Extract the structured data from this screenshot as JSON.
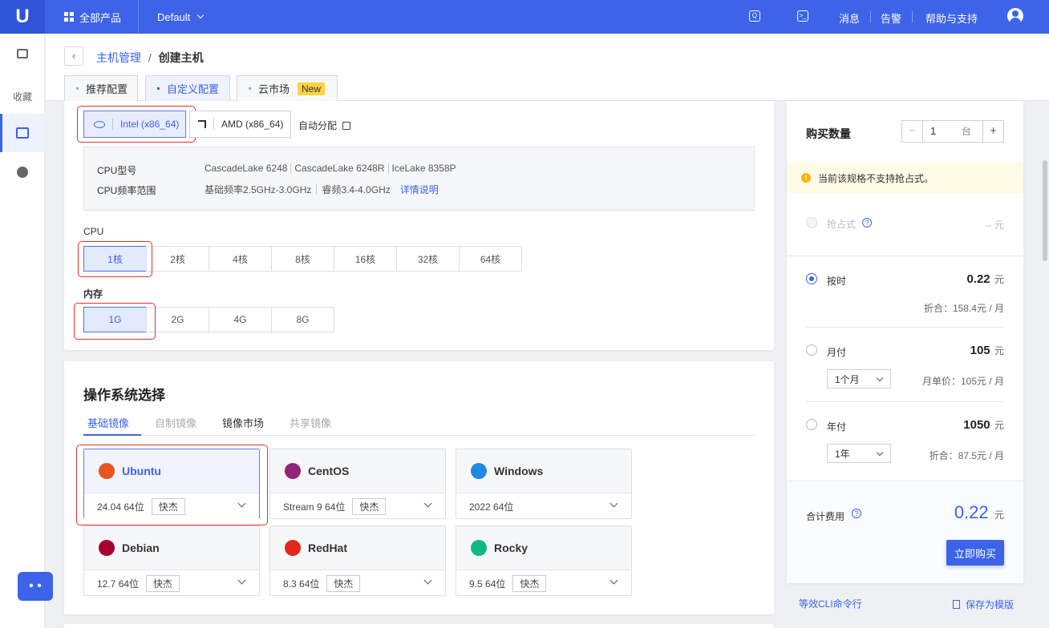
{
  "topbar": {
    "logo": "U",
    "all_products": "全部产品",
    "project": "Default",
    "messages": "消息",
    "alerts": "告警",
    "help": "帮助与支持"
  },
  "sidebar": {
    "favorites": "收藏"
  },
  "breadcrumb": {
    "parent": "主机管理",
    "sep": "/",
    "current": "创建主机"
  },
  "tabs": [
    {
      "label": "推荐配置"
    },
    {
      "label": "自定义配置"
    },
    {
      "label": "云市场",
      "badge": "New"
    }
  ],
  "cpu_arch": {
    "intel": "Intel (x86_64)",
    "amd": "AMD (x86_64)",
    "auto": "自动分配"
  },
  "spec": {
    "model_label": "CPU型号",
    "models": [
      "CascadeLake 6248",
      "CascadeLake 6248R",
      "IceLake 8358P"
    ],
    "freq_label": "CPU频率范围",
    "base_freq": "基础频率2.5GHz-3.0GHz",
    "turbo": "睿频3.4-4.0GHz",
    "details": "详情说明"
  },
  "cpu": {
    "label": "CPU",
    "options": [
      "1核",
      "2核",
      "4核",
      "8核",
      "16核",
      "32核",
      "64核"
    ],
    "selected": "1核"
  },
  "memory": {
    "label": "内存",
    "options": [
      "1G",
      "2G",
      "4G",
      "8G"
    ],
    "selected": "1G"
  },
  "os": {
    "title": "操作系统选择",
    "tabs": [
      "基础镜像",
      "自制镜像",
      "镜像市场",
      "共享镜像"
    ],
    "images": [
      {
        "name": "Ubuntu",
        "version": "24.04 64位",
        "tag": "快杰",
        "color": "#e95420"
      },
      {
        "name": "CentOS",
        "version": "Stream 9 64位",
        "tag": "快杰",
        "color": "#932279"
      },
      {
        "name": "Windows",
        "version": "2022 64位",
        "tag": "",
        "color": "#1e88e5"
      },
      {
        "name": "Debian",
        "version": "12.7 64位",
        "tag": "快杰",
        "color": "#a80030"
      },
      {
        "name": "RedHat",
        "version": "8.3 64位",
        "tag": "快杰",
        "color": "#e0281f"
      },
      {
        "name": "Rocky",
        "version": "9.5 64位",
        "tag": "快杰",
        "color": "#10b981"
      }
    ]
  },
  "purchase": {
    "qty_label": "购买数量",
    "qty": "1",
    "qty_unit": "台",
    "warning": "当前该规格不支持抢占式。",
    "preempt": {
      "label": "抢占式",
      "price": "-- 元"
    },
    "hourly": {
      "label": "按时",
      "price": "0.22",
      "unit": "元",
      "note": "折合：158.4元 / 月"
    },
    "monthly": {
      "label": "月付",
      "price": "105",
      "unit": "元",
      "duration": "1个月",
      "note": "月单价：105元 / 月"
    },
    "yearly": {
      "label": "年付",
      "price": "1050",
      "unit": "元",
      "duration": "1年",
      "note": "折合：87.5元 / 月"
    },
    "total_label": "合计费用",
    "total": "0.22",
    "total_unit": "元",
    "buy": "立即购买",
    "cli": "等效CLI命令行",
    "save_template": "保存为模版"
  },
  "colors": {
    "primary": "#3c63e8",
    "highlight": "#e2322b",
    "warning_bg": "#fffbe6"
  }
}
